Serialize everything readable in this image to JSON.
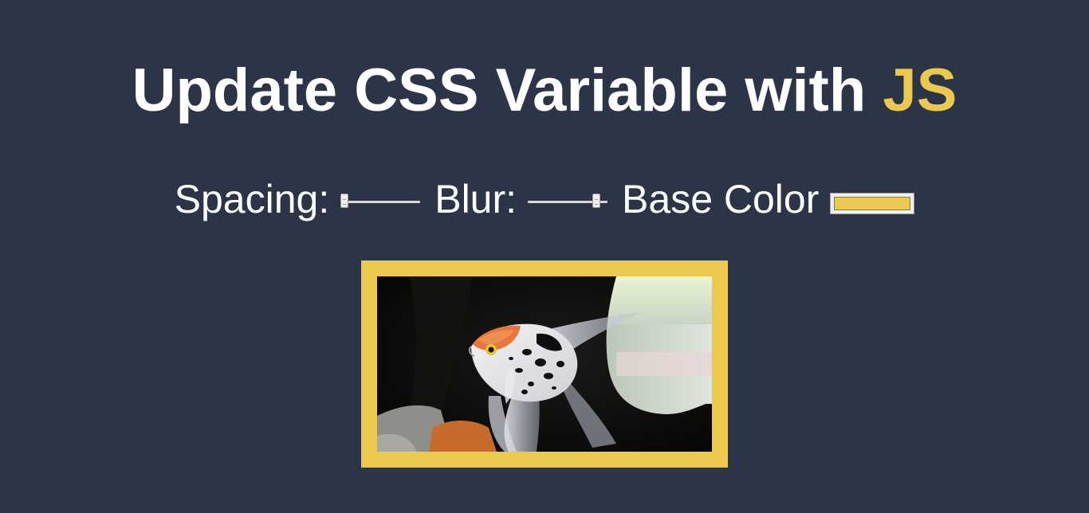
{
  "heading": {
    "text": "Update CSS Variable with ",
    "highlight": "JS",
    "highlight_color": "#ebc94f"
  },
  "controls": {
    "spacing": {
      "label": "Spacing:",
      "value_fraction": 0.0
    },
    "blur": {
      "label": "Blur:",
      "value_fraction": 0.9
    },
    "base_color": {
      "label": "Base Color",
      "value": "#ebc94f"
    }
  },
  "image": {
    "subject": "angelfish-photo",
    "border_color": "#ebc94f"
  },
  "colors": {
    "background": "#2c3547",
    "text": "#ffffff",
    "accent": "#ebc94f"
  }
}
